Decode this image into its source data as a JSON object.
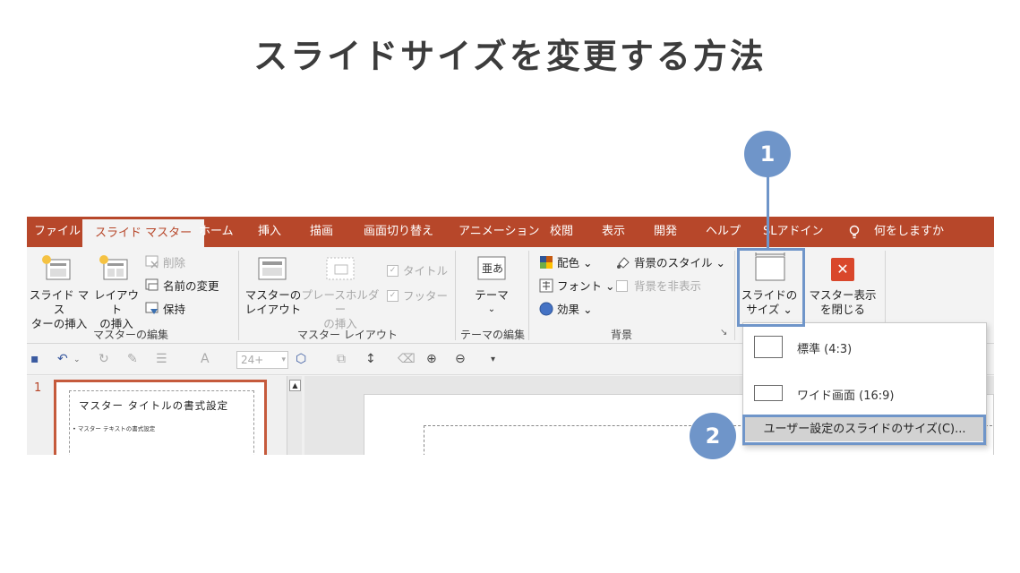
{
  "page": {
    "title": "スライドサイズを変更する方法"
  },
  "tabs": [
    "ファイル",
    "スライド マスター",
    "ホーム",
    "挿入",
    "描画",
    "画面切り替え",
    "アニメーション",
    "校閲",
    "表示",
    "開発",
    "ヘルプ",
    "SLアドイン",
    "何をしますか"
  ],
  "ribbon": {
    "master_edit": {
      "insert_master_1": "スライド マス",
      "insert_master_2": "ターの挿入",
      "insert_layout_1": "レイアウト",
      "insert_layout_2": "の挿入",
      "delete": "削除",
      "rename": "名前の変更",
      "preserve": "保持",
      "label": "マスターの編集"
    },
    "master_layout": {
      "master_layout_1": "マスターの",
      "master_layout_2": "レイアウト",
      "placeholder_1": "プレースホルダー",
      "placeholder_2": "の挿入",
      "title_check": "タイトル",
      "footer_check": "フッター",
      "label": "マスター レイアウト"
    },
    "theme_edit": {
      "theme": "テーマ",
      "label": "テーマの編集"
    },
    "background": {
      "colors": "配色",
      "fonts": "フォント",
      "effects": "効果",
      "bg_styles": "背景のスタイル",
      "hide_bg": "背景を非表示",
      "label": "背景"
    },
    "size": {
      "slide_size_1": "スライドの",
      "slide_size_2": "サイズ"
    },
    "close": {
      "close_1": "マスター表示",
      "close_2": "を閉じる"
    }
  },
  "qat": {
    "font_size": "24+",
    "font_letter": "A"
  },
  "thumbnail": {
    "number": "1",
    "title": "マスター タイトルの書式設定",
    "body": "• マスター テキストの書式設定"
  },
  "dropdown": {
    "standard": "標準 (4:3)",
    "wide": "ワイド画面 (16:9)",
    "custom": "ユーザー設定のスライドのサイズ(C)..."
  },
  "badges": [
    "1",
    "2"
  ],
  "colors": {
    "accent": "#b7472a",
    "highlight": "#6f95c9",
    "close_x": "#d9472b"
  }
}
